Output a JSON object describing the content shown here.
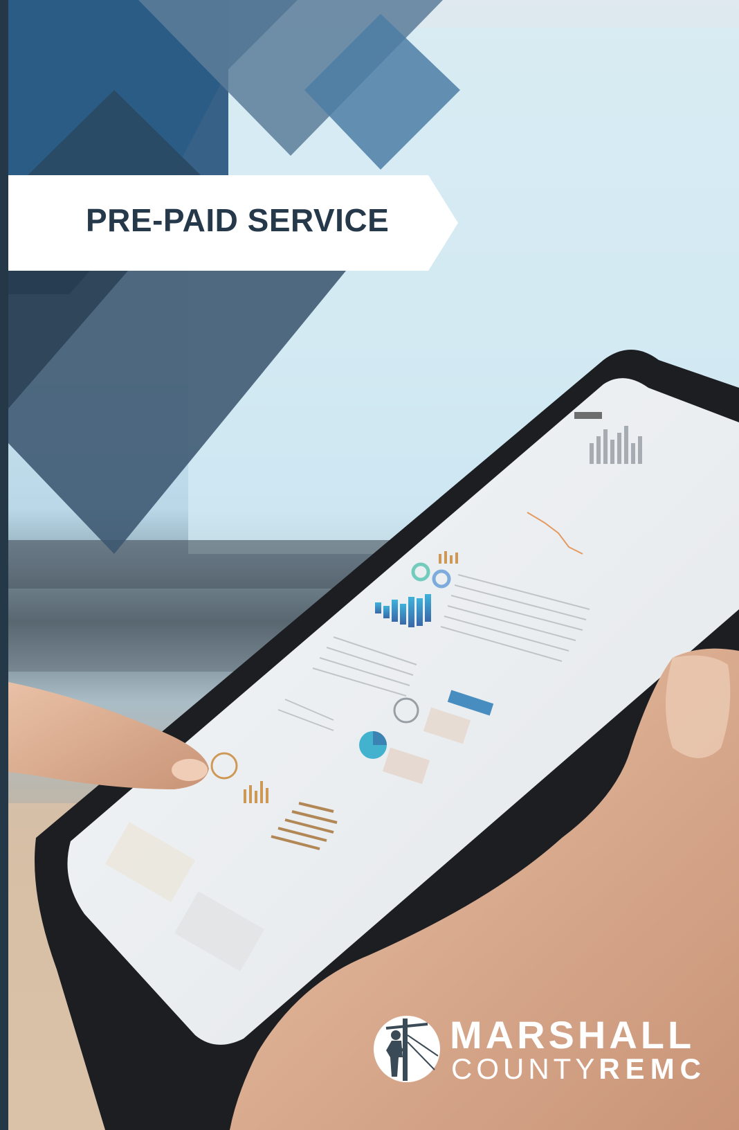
{
  "title": "PRE-PAID SERVICE",
  "logo": {
    "line1": "MARSHALL",
    "line2_a": "COUNTY",
    "line2_b": "REMC",
    "icon": "lineworker-on-pole-icon"
  },
  "colors": {
    "banner_text": "#26394a",
    "diamond_dark": "#2e4a63",
    "diamond_mid": "#3f6587",
    "diamond_light": "#6c8fae",
    "logo": "#ffffff"
  }
}
